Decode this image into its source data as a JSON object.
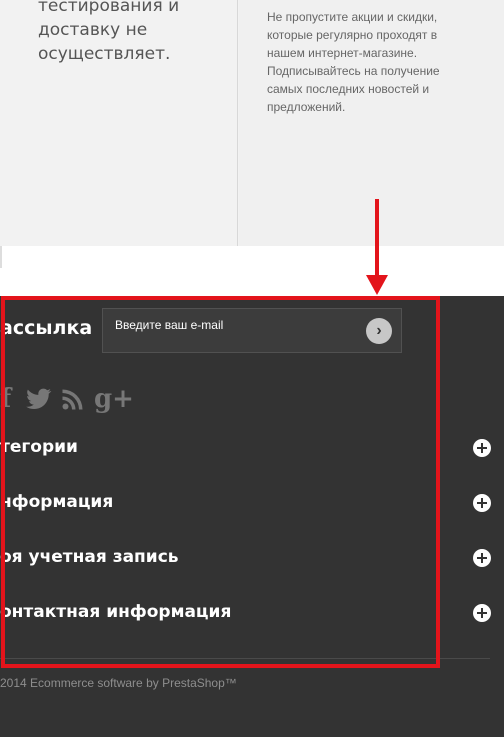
{
  "top": {
    "left_text": "тестирования и доставку не осуществляет.",
    "right_text": "Не пропустите акции и скидки, которые регулярно проходят в нашем интернет-магазине. Подписывайтесь на получение самых последних новостей и предложений."
  },
  "newsletter": {
    "title": "ассылка",
    "input_value": "Введите ваш e-mail",
    "submit_glyph": "›"
  },
  "social": {
    "icons": [
      "facebook-icon",
      "twitter-icon",
      "rss-icon",
      "google-plus-icon"
    ],
    "facebook_glyph": "f",
    "gplus_glyph": "g+"
  },
  "accordion": [
    {
      "label": "тегории"
    },
    {
      "label": "нформация"
    },
    {
      "label": "оя учетная запись"
    },
    {
      "label": "онтактная информация"
    }
  ],
  "copyright": "2014 Ecommerce software by PrestaShop™",
  "colors": {
    "highlight": "#e3141b",
    "footer_bg": "#333333"
  }
}
